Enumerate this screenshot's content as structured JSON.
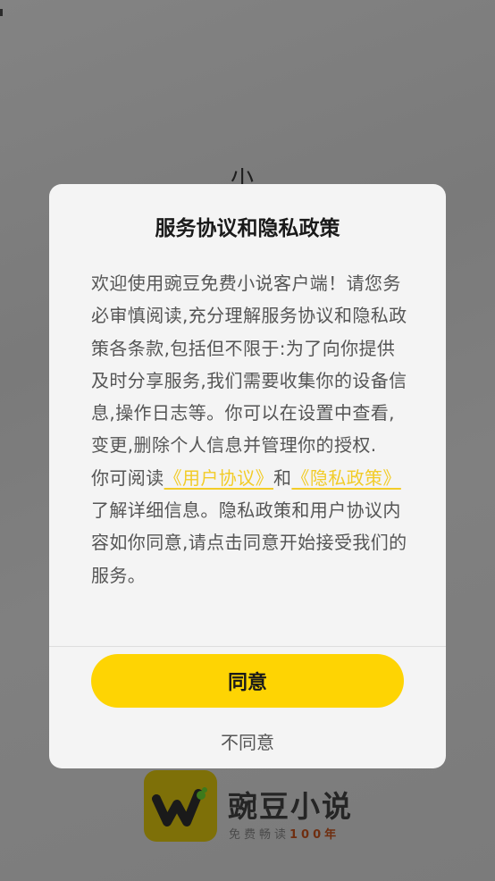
{
  "background": {
    "glyph": "小"
  },
  "dialog": {
    "title": "服务协议和隐私政策",
    "paragraph_1": "欢迎使用豌豆免费小说客户端！请您务必审慎阅读,充分理解服务协议和隐私政策各条款,包括但不限于:为了向你提供及时分享服务,我们需要收集你的设备信息,操作日志等。你可以在设置中查看,变更,删除个人信息并管理你的授权.",
    "paragraph_2_prefix": "你可阅读",
    "user_agreement_link": "《用户协议》",
    "and_text": "和",
    "privacy_policy_link": "《隐私政策》",
    "paragraph_2_suffix": "了解详细信息。隐私政策和用户协议内容如你同意,请点击同意开始接受我们的服务。",
    "agree_label": "同意",
    "disagree_label": "不同意"
  },
  "brand": {
    "name": "豌豆小说",
    "tagline_prefix": "免费畅读",
    "tagline_accent": "100年"
  },
  "colors": {
    "accent": "#fed403",
    "link": "#f2cc28",
    "overlay": "#7d7d7d",
    "dialog_bg": "#f4f4f4"
  }
}
